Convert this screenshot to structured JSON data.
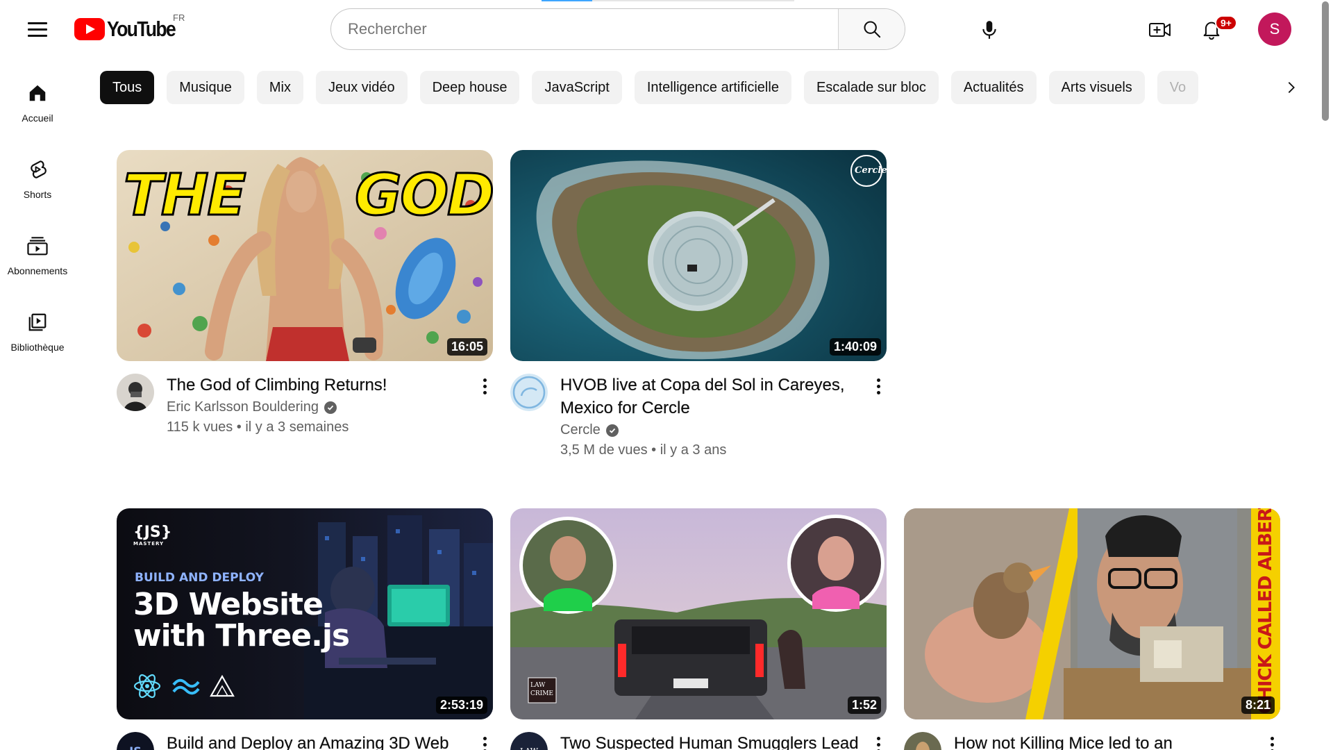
{
  "header": {
    "logo_text": "YouTube",
    "country": "FR",
    "search_placeholder": "Rechercher",
    "notif_badge": "9+",
    "avatar_initial": "S",
    "progress": 0.2
  },
  "sidebar": {
    "items": [
      {
        "label": "Accueil",
        "icon": "home-icon"
      },
      {
        "label": "Shorts",
        "icon": "shorts-icon"
      },
      {
        "label": "Abonnements",
        "icon": "subscriptions-icon"
      },
      {
        "label": "Bibliothèque",
        "icon": "library-icon"
      }
    ]
  },
  "chips": [
    "Tous",
    "Musique",
    "Mix",
    "Jeux vidéo",
    "Deep house",
    "JavaScript",
    "Intelligence artificielle",
    "Escalade sur bloc",
    "Actualités",
    "Arts visuels",
    "Vo"
  ],
  "videos": [
    {
      "title": "The God of Climbing Returns!",
      "channel": "Eric Karlsson Bouldering",
      "verified": true,
      "stats": "115 k vues • il y a 3 semaines",
      "duration": "16:05",
      "thumb_text": "THE GOD"
    },
    {
      "title": "HVOB live at Copa del Sol in Careyes, Mexico for Cercle",
      "channel": "Cercle",
      "verified": true,
      "stats": "3,5 M de vues • il y a 3 ans",
      "duration": "1:40:09",
      "thumb_text": "Cercle"
    },
    {
      "title": "Build and Deploy an Amazing 3D Web",
      "duration": "2:53:19",
      "thumb_brand": "{JS}",
      "thumb_brand_sub": "MASTERY",
      "thumb_kicker": "BUILD AND DEPLOY",
      "thumb_line1": "3D Website",
      "thumb_line2": "with Three.js"
    },
    {
      "title": "Two Suspected Human Smugglers Lead",
      "duration": "1:52",
      "thumb_badge1": "LAW",
      "thumb_badge2": "CRIME"
    },
    {
      "title": "How not Killing Mice led to an",
      "duration": "8:21",
      "thumb_text": "CHICK CALLED ALBERT"
    }
  ],
  "colors": {
    "brand_red": "#ff0000",
    "chip_active": "#0f0f0f",
    "chip_bg": "#f2f2f2",
    "secondary_text": "#606060",
    "avatar": "#c2185b"
  }
}
